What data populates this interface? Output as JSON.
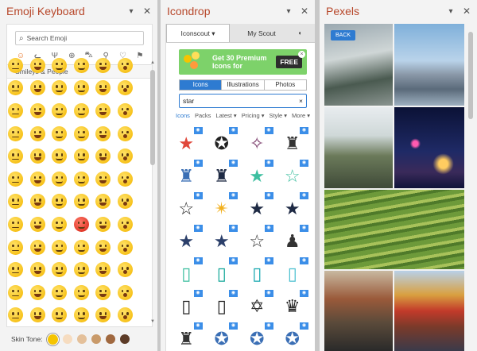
{
  "emoji_pane": {
    "title": "Emoji Keyboard",
    "search_placeholder": "Search Emoji",
    "section": "Smileys & People",
    "skin_tone_label": "Skin Tone:",
    "categories": [
      "smiley-icon",
      "cat-icon",
      "food-icon",
      "ball-icon",
      "car-icon",
      "bulb-icon",
      "heart-icon",
      "flag-icon"
    ],
    "skin_tones": [
      "#f5c400",
      "#f6dcc0",
      "#e4c09a",
      "#c99a6a",
      "#a0683f",
      "#5c3b26"
    ]
  },
  "icondrop_pane": {
    "title": "Icondrop",
    "tabs": [
      "Iconscout ▾",
      "My Scout"
    ],
    "banner_text": "Get 30 Premium Icons for",
    "banner_badge": "FREE",
    "segments": [
      "Icons",
      "Illustrations",
      "Photos"
    ],
    "search_value": "star",
    "clear_icon": "×",
    "filters": [
      "Icons",
      "Packs",
      "Latest ▾",
      "Pricing ▾",
      "Style ▾",
      "More ▾"
    ]
  },
  "pexels_pane": {
    "title": "Pexels",
    "back_label": "BACK"
  },
  "colors": {
    "title_accent": "#b7472a",
    "primary_blue": "#2e7bd1",
    "banner_green": "#7dd26a"
  }
}
